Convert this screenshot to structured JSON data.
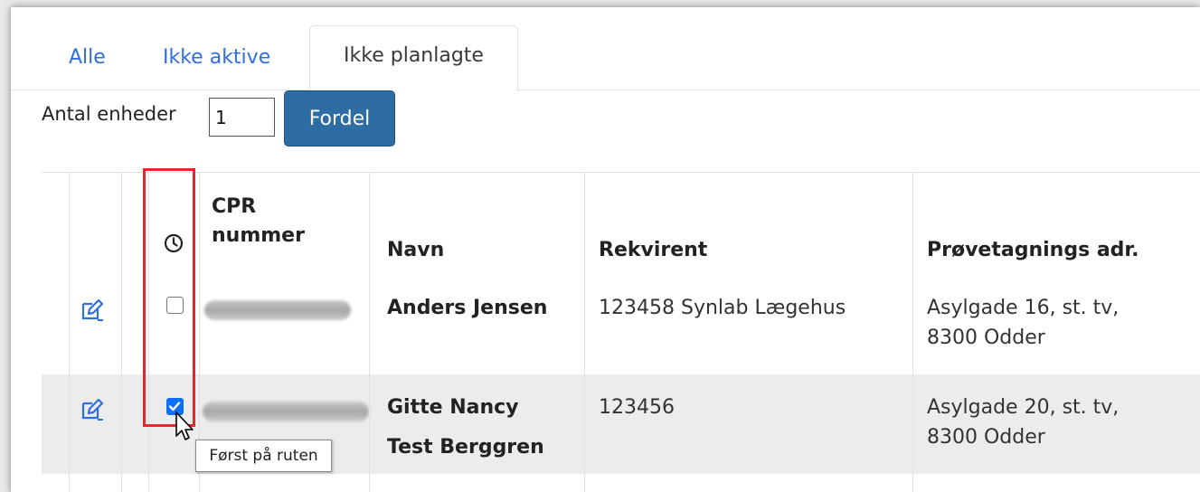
{
  "tabs": [
    {
      "label": "Alle",
      "active": false
    },
    {
      "label": "Ikke aktive",
      "active": false
    },
    {
      "label": "Ikke planlagte",
      "active": true
    }
  ],
  "toolbar": {
    "units_label": "Antal enheder",
    "units_value": "1",
    "distribute_label": "Fordel"
  },
  "table": {
    "headers": {
      "clock_icon": "clock-icon",
      "cpr_line1": "CPR",
      "cpr_line2": "nummer",
      "name": "Navn",
      "requester": "Rekvirent",
      "address": "Prøvetagnings adr."
    },
    "rows": [
      {
        "name_line1": "Anders Jensen",
        "name_line2": "",
        "requester": "123458 Synlab Lægehus",
        "address_line1": "Asylgade 16, st. tv,",
        "address_line2": "8300 Odder",
        "first_on_route": false,
        "cpr": "redacted"
      },
      {
        "name_line1": "Gitte Nancy",
        "name_line2": "Test Berggren",
        "requester": "123456",
        "address_line1": "Asylgade 20, st. tv,",
        "address_line2": "8300 Odder",
        "first_on_route": true,
        "cpr": "redacted"
      }
    ]
  },
  "tooltip": "Først på ruten",
  "colors": {
    "link": "#2f6fde",
    "button": "#2e6da4",
    "highlight": "#e8262b",
    "checkbox_checked": "#0d6efd"
  }
}
